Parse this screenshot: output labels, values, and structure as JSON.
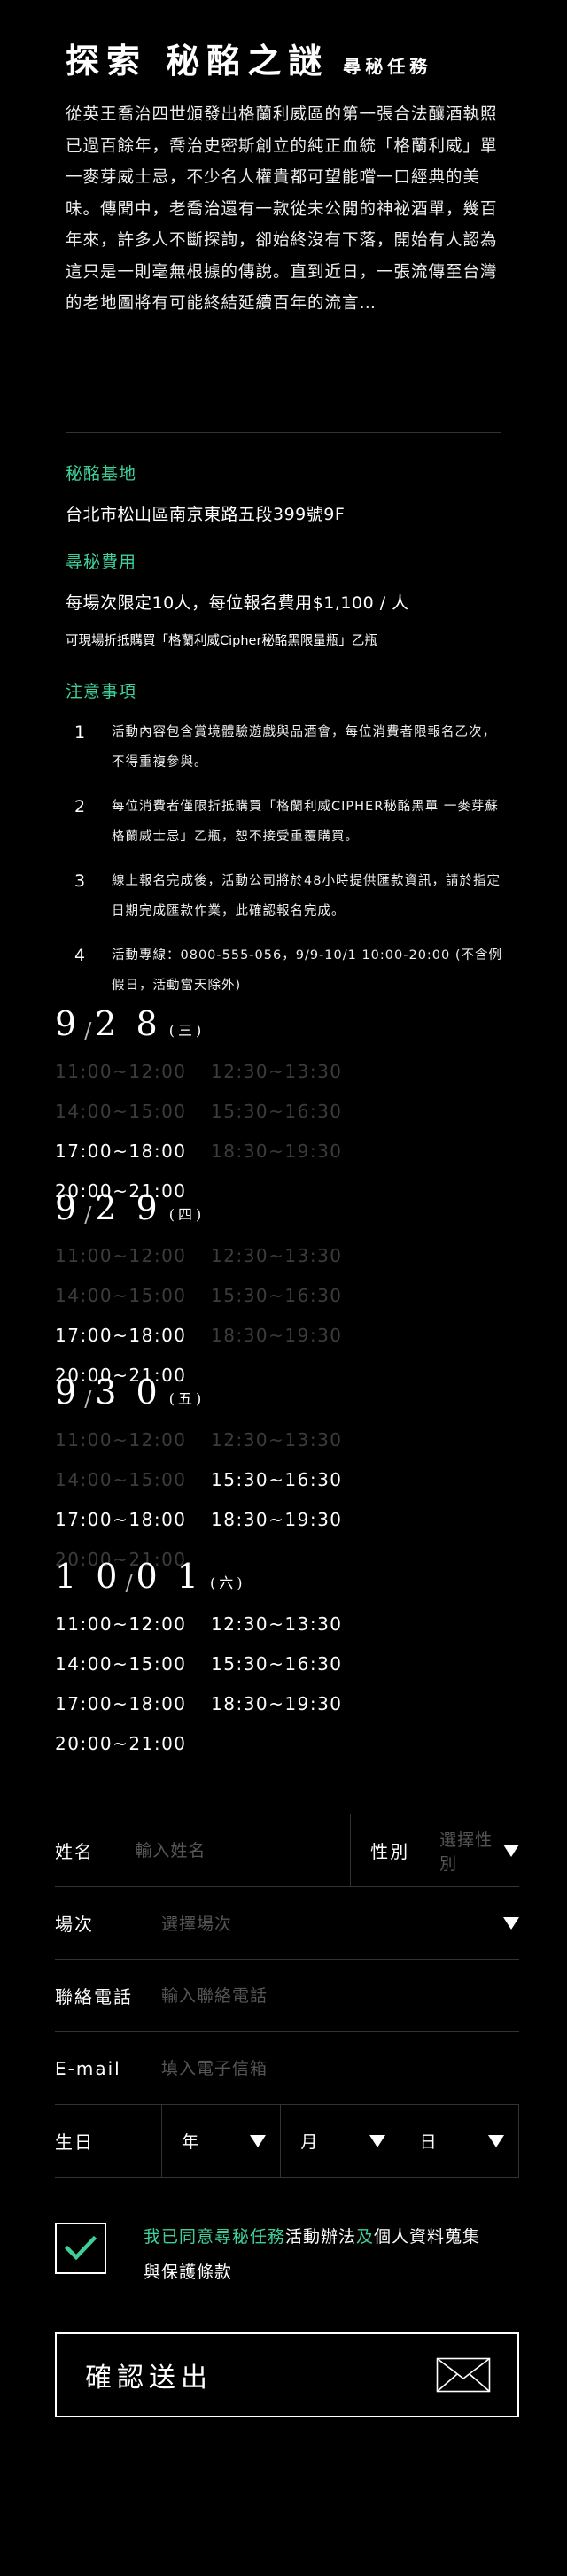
{
  "header": {
    "title": "探索 秘酩之謎",
    "subtitle": "尋秘任務"
  },
  "story": "從英王喬治四世頒發出格蘭利威區的第一張合法釀酒執照已過百餘年，喬治史密斯創立的純正血統「格蘭利威」單一麥芽威士忌，不少名人權貴都可望能嚐一口經典的美味。傳聞中，老喬治還有一款從未公開的神祕酒單，幾百年來，許多人不斷探詢，卻始終沒有下落，開始有人認為這只是一則毫無根據的傳說。直到近日，一張流傳至台灣的老地圖將有可能終結延續百年的流言…",
  "info": {
    "base_label": "秘酩基地",
    "base_address": "台北市松山區南京東路五段399號9F",
    "fee_label": "尋秘費用",
    "fee_text": "每場次限定10人，每位報名費用$1,100 / 人",
    "fee_note": "可現場折抵購買「格蘭利威Cipher秘酩黑限量瓶」乙瓶",
    "notes_label": "注意事項"
  },
  "notes": [
    {
      "num": "1",
      "text": "活動內容包含賞境體驗遊戲與品酒會，每位消費者限報名乙次，不得重複參與。"
    },
    {
      "num": "2",
      "text": "每位消費者僅限折抵購買「格蘭利威CIPHER秘酩黑單 一麥芽蘇格蘭威士忌」乙瓶，恕不接受重覆購買。"
    },
    {
      "num": "3",
      "text": "線上報名完成後，活動公司將於48小時提供匯款資訊，請於指定日期完成匯款作業，此確認報名完成。"
    },
    {
      "num": "4",
      "text": "活動專線：0800-555-056，9/9-10/1 10:00-20:00 (不含例假日，活動當天除外)"
    }
  ],
  "sessions": [
    {
      "month": "9",
      "sep": "/",
      "day": "2 8",
      "weekday": "(三)",
      "slots": [
        {
          "time": "11:00~12:00",
          "available": false
        },
        {
          "time": "12:30~13:30",
          "available": false
        },
        {
          "time": "14:00~15:00",
          "available": false
        },
        {
          "time": "15:30~16:30",
          "available": false
        },
        {
          "time": "17:00~18:00",
          "available": true
        },
        {
          "time": "18:30~19:30",
          "available": false
        },
        {
          "time": "20:00~21:00",
          "available": true
        }
      ]
    },
    {
      "month": "9",
      "sep": "/",
      "day": "2 9",
      "weekday": "(四)",
      "slots": [
        {
          "time": "11:00~12:00",
          "available": false
        },
        {
          "time": "12:30~13:30",
          "available": false
        },
        {
          "time": "14:00~15:00",
          "available": false
        },
        {
          "time": "15:30~16:30",
          "available": false
        },
        {
          "time": "17:00~18:00",
          "available": true
        },
        {
          "time": "18:30~19:30",
          "available": false
        },
        {
          "time": "20:00~21:00",
          "available": true
        }
      ]
    },
    {
      "month": "9",
      "sep": "/",
      "day": "3 0",
      "weekday": "(五)",
      "slots": [
        {
          "time": "11:00~12:00",
          "available": false
        },
        {
          "time": "12:30~13:30",
          "available": false
        },
        {
          "time": "14:00~15:00",
          "available": false
        },
        {
          "time": "15:30~16:30",
          "available": true
        },
        {
          "time": "17:00~18:00",
          "available": true
        },
        {
          "time": "18:30~19:30",
          "available": true
        },
        {
          "time": "20:00~21:00",
          "available": false
        }
      ]
    },
    {
      "month": "1 0",
      "sep": "/",
      "day": "0 1",
      "weekday": "(六)",
      "slots": [
        {
          "time": "11:00~12:00",
          "available": true
        },
        {
          "time": "12:30~13:30",
          "available": true
        },
        {
          "time": "14:00~15:00",
          "available": true
        },
        {
          "time": "15:30~16:30",
          "available": true
        },
        {
          "time": "17:00~18:00",
          "available": true
        },
        {
          "time": "18:30~19:30",
          "available": true
        },
        {
          "time": "20:00~21:00",
          "available": true
        }
      ]
    }
  ],
  "form": {
    "name_label": "姓名",
    "name_placeholder": "輸入姓名",
    "gender_label": "性別",
    "gender_placeholder": "選擇性別",
    "session_label": "場次",
    "session_placeholder": "選擇場次",
    "phone_label": "聯絡電話",
    "phone_placeholder": "輸入聯絡電話",
    "email_label": "E-mail",
    "email_placeholder": "填入電子信箱",
    "dob_label": "生日",
    "year": "年",
    "month": "月",
    "day": "日"
  },
  "agree": {
    "checked": true,
    "prefix": "我已同意尋秘任務",
    "rules": "活動辦法",
    "and": "及",
    "privacy": "個人資料蒐集與保護條款"
  },
  "submit": {
    "label": "確認送出"
  },
  "colors": {
    "accent": "#3fd09a",
    "background": "#000000",
    "unavailable": "#3c3c3c",
    "divider": "#333333"
  },
  "icons": {
    "check": "check-icon",
    "envelope": "envelope-icon",
    "caret": "caret-down-icon"
  }
}
